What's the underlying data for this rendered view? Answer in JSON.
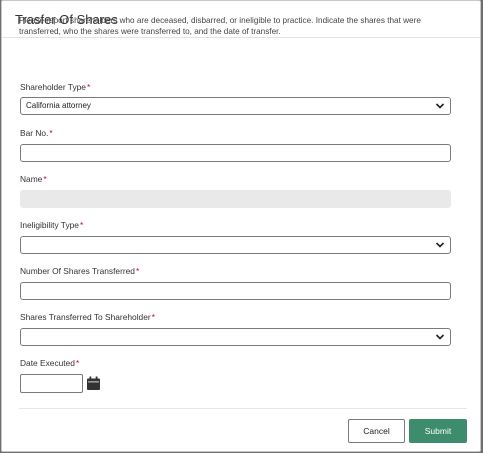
{
  "modal": {
    "title": "Trasfer Of Shares",
    "instructions": "Please report shareholders who are deceased, disbarred, or ineligible to practice. Indicate the shares that were transferred, who the shares were transferred to, and the date of transfer.",
    "required_marker": "*"
  },
  "fields": {
    "shareholder_type": {
      "label": "Shareholder Type",
      "value": "California attorney"
    },
    "bar_no": {
      "label": "Bar No.",
      "value": ""
    },
    "name": {
      "label": "Name",
      "value": ""
    },
    "ineligibility_type": {
      "label": "Ineligibility Type",
      "value": ""
    },
    "shares_transferred": {
      "label": "Number Of Shares Transferred",
      "value": ""
    },
    "transferred_to": {
      "label": "Shares Transferred To Shareholder",
      "value": ""
    },
    "date_executed": {
      "label": "Date Executed",
      "value": ""
    }
  },
  "actions": {
    "cancel_label": "Cancel",
    "submit_label": "Submit"
  },
  "icons": {
    "select_arrow": "chevron-down-icon",
    "date_picker": "calendar-icon"
  },
  "colors": {
    "submit_bg": "#3d8c6d",
    "required": "#d0021b"
  }
}
